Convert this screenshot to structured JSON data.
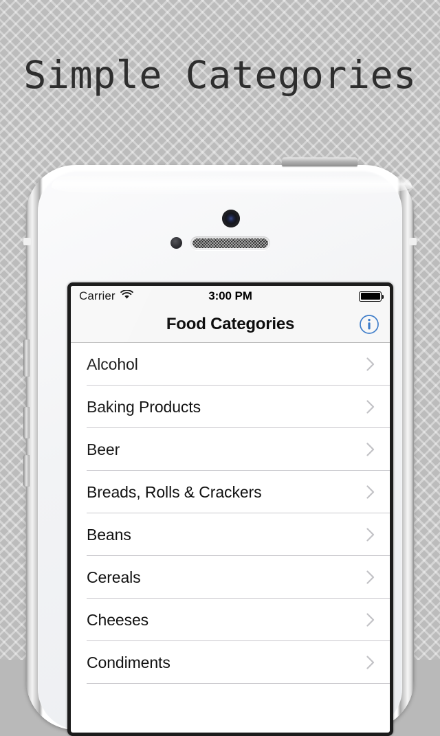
{
  "page": {
    "headline": "Simple Categories",
    "background_color": "#bcbcbc"
  },
  "device": {
    "color": "white",
    "hardware": {
      "power_button": "power-button",
      "mute_switch": "mute-switch",
      "volume_up": "volume-up",
      "volume_down": "volume-down",
      "front_camera": "front-camera",
      "ambient_sensor": "ambient-light-sensor",
      "earpiece": "earpiece-speaker"
    }
  },
  "screen": {
    "status_bar": {
      "carrier": "Carrier",
      "wifi_icon": "wifi-icon",
      "time": "3:00 PM",
      "battery_icon": "battery-full-icon",
      "battery_level": 100
    },
    "nav_bar": {
      "title": "Food Categories",
      "info_button_icon": "info-circle-icon",
      "info_button_color": "#3d7cc9",
      "background_color": "#f7f7f7"
    },
    "list": {
      "accessory_icon": "chevron-right-icon",
      "separator_color": "#c8c7cc",
      "rows": [
        {
          "label": "Alcohol"
        },
        {
          "label": "Baking Products"
        },
        {
          "label": "Beer"
        },
        {
          "label": "Breads, Rolls & Crackers"
        },
        {
          "label": "Beans"
        },
        {
          "label": "Cereals"
        },
        {
          "label": "Cheeses"
        },
        {
          "label": "Condiments"
        }
      ]
    }
  }
}
